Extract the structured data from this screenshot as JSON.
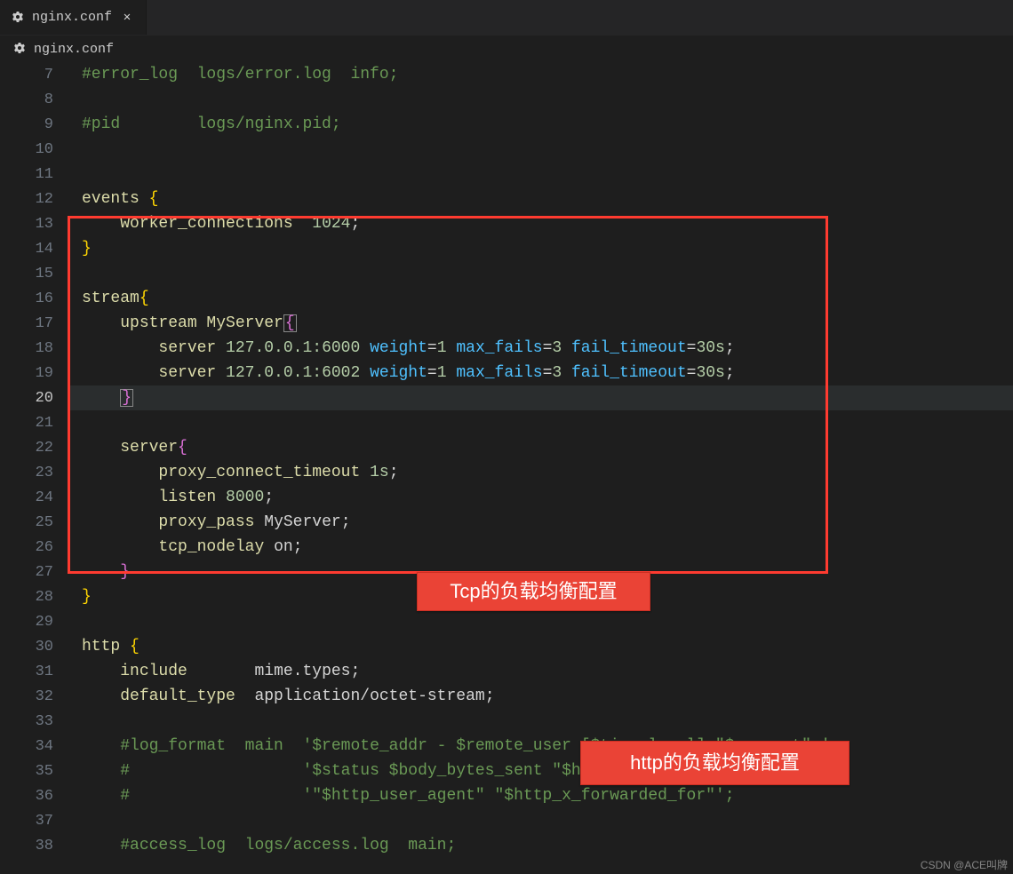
{
  "tab": {
    "title": "nginx.conf",
    "icon": "gear-icon"
  },
  "breadcrumb": {
    "title": "nginx.conf",
    "icon": "gear-icon"
  },
  "startLine": 7,
  "currentLine": 20,
  "code": {
    "l7": {
      "comment": "#error_log  logs/error.log  info;"
    },
    "l9": {
      "comment": "#pid        logs/nginx.pid;"
    },
    "l12": {
      "kw": "events"
    },
    "l13": {
      "kw": "worker_connections",
      "num": "1024"
    },
    "l16": {
      "kw": "stream"
    },
    "l17": {
      "kw": "upstream MyServer"
    },
    "l18": {
      "kw": "server",
      "addr": "127.0.0.1:6000",
      "opts": [
        [
          "weight",
          "1"
        ],
        [
          "max_fails",
          "3"
        ],
        [
          "fail_timeout",
          "30s"
        ]
      ]
    },
    "l19": {
      "kw": "server",
      "addr": "127.0.0.1:6002",
      "opts": [
        [
          "weight",
          "1"
        ],
        [
          "max_fails",
          "3"
        ],
        [
          "fail_timeout",
          "30s"
        ]
      ]
    },
    "l22": {
      "kw": "server"
    },
    "l23": {
      "kw": "proxy_connect_timeout",
      "val": "1s"
    },
    "l24": {
      "kw": "listen",
      "val": "8000"
    },
    "l25": {
      "kw": "proxy_pass",
      "val": "MyServer"
    },
    "l26": {
      "kw": "tcp_nodelay",
      "val": "on"
    },
    "l30": {
      "kw": "http"
    },
    "l31": {
      "kw": "include",
      "val": "mime.types"
    },
    "l32": {
      "kw": "default_type",
      "val": "application/octet-stream"
    },
    "l34": {
      "comment": "#log_format  main  '$remote_addr - $remote_user [$time_local] \"$request\" '"
    },
    "l35": {
      "comment": "#                  '$status $body_bytes_sent \"$http_referer\" '"
    },
    "l36": {
      "comment": "#                  '\"$http_user_agent\" \"$http_x_forwarded_for\"';"
    },
    "l38": {
      "comment": "#access_log  logs/access.log  main;"
    }
  },
  "callouts": {
    "tcp": "Tcp的负载均衡配置",
    "http": "http的负载均衡配置"
  },
  "watermark": "CSDN @ACE叫牌"
}
